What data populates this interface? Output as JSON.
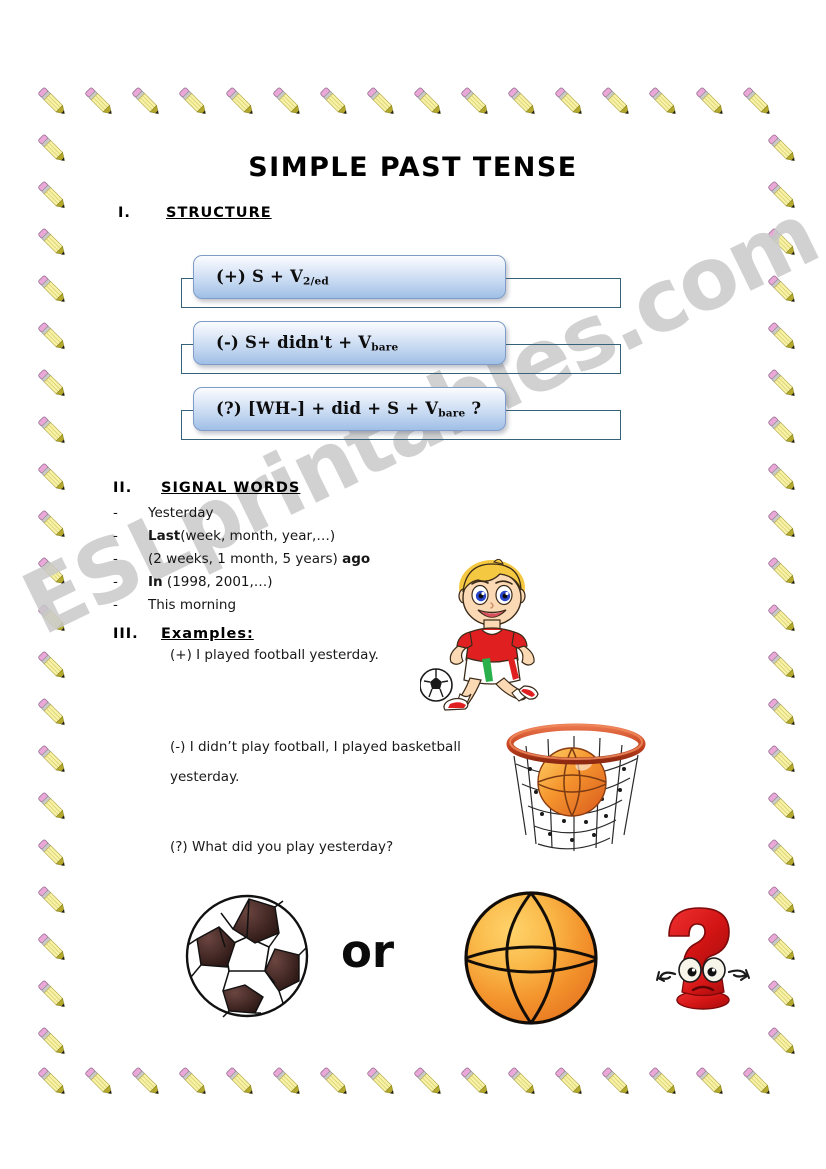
{
  "document": {
    "title": "SIMPLE PAST TENSE",
    "watermark": "ESLprintables.com",
    "border_icon": "pencil-icon"
  },
  "sections": {
    "structure": {
      "numeral": "I.",
      "label": "STRUCTURE",
      "formulas": [
        {
          "id": "affirmative",
          "prefix": "(+) S + V",
          "sub": "2/ed",
          "suffix": ""
        },
        {
          "id": "negative",
          "prefix": "(-) S+  didn't + V",
          "sub": "bare",
          "suffix": ""
        },
        {
          "id": "question",
          "prefix": "(?) [WH-] + did + S + V",
          "sub": "bare",
          "suffix": " ?"
        }
      ]
    },
    "signal_words": {
      "numeral": "II.",
      "label": "SIGNAL WORDS",
      "bullet": "-",
      "items": [
        {
          "plain_before": "Yesterday",
          "bold": "",
          "plain_after": ""
        },
        {
          "plain_before": "",
          "bold": "Last",
          "plain_after": "(week, month, year,…)"
        },
        {
          "plain_before": "(2 weeks, 1 month, 5 years) ",
          "bold": "ago",
          "plain_after": ""
        },
        {
          "plain_before": "",
          "bold": "In",
          "plain_after": " (1998, 2001,…)"
        },
        {
          "plain_before": "This morning",
          "bold": "",
          "plain_after": ""
        }
      ]
    },
    "examples": {
      "numeral": "III.",
      "label": "Examples:",
      "items": [
        "(+) I played football yesterday.",
        "(-) I didn’t play football, I played basketball\nyesterday.",
        "(?) What did you play yesterday?"
      ]
    }
  },
  "illustrations": {
    "boy_playing_football": "boy-playing-football-icon",
    "basketball_hoop": "basketball-hoop-icon",
    "soccer_ball": "soccer-ball-icon",
    "basketball": "basketball-icon",
    "question_mark_character": "question-mark-character-icon",
    "or_label": "or"
  },
  "colors": {
    "box_border": "#35627b",
    "box_gradient_top": "#fbfcfe",
    "box_gradient_bottom": "#9fbfe6",
    "pencil_body": "#f5f0a0",
    "pencil_eraser": "#e9a8d8",
    "watermark": "#c9c9c9",
    "basketball": "#f0932a",
    "hoop_rim": "#d4542a",
    "question_red": "#e01b1b",
    "shirt_red": "#e02020"
  }
}
